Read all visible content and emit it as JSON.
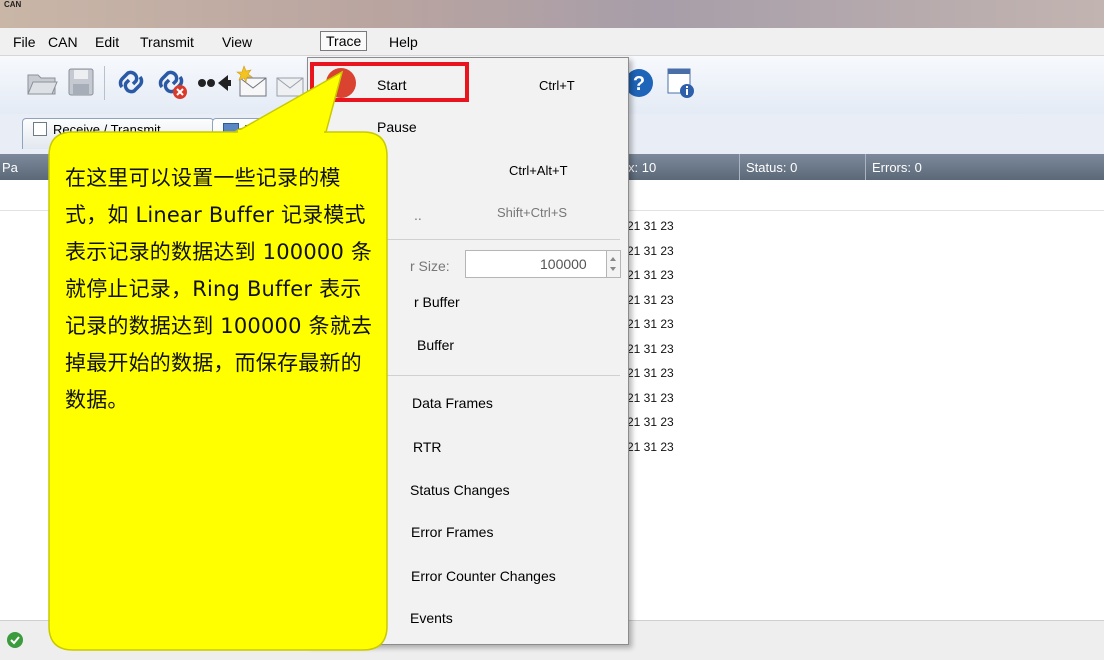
{
  "window": {
    "mini_title": "CAN"
  },
  "menubar": {
    "file": "File",
    "can": "CAN",
    "edit": "Edit",
    "transmit": "Transmit",
    "view": "View",
    "trace": "Trace",
    "help": "Help"
  },
  "tabs": {
    "receive_transmit": "Receive / Transmit",
    "trace": "Tr"
  },
  "status": {
    "rx": "x: 10",
    "status": "Status: 0",
    "errors": "Errors: 0",
    "partial_left": "Pa"
  },
  "trace_rows": [
    "21 31 23",
    "21 31 23",
    "21 31 23",
    "21 31 23",
    "21 31 23",
    "21 31 23",
    "21 31 23",
    "21 31 23",
    "21 31 23",
    "21 31 23"
  ],
  "trace_menu": {
    "start": "Start",
    "start_shortcut": "Ctrl+T",
    "pause": "Pause",
    "item3_shortcut": "Ctrl+Alt+T",
    "item4_partial": "..",
    "item4_shortcut": "Shift+Ctrl+S",
    "buffer_size_label": "r Size:",
    "buffer_size_value": "100000",
    "linear_buffer": "r Buffer",
    "ring_buffer": "Buffer",
    "data_frames": "Data Frames",
    "rtr": "RTR",
    "status_changes": "Status Changes",
    "error_frames": "Error Frames",
    "error_counter_changes": "Error Counter Changes",
    "events": "Events"
  },
  "callout": {
    "text": "在这里可以设置一些记录的模式，如 Linear Buffer 记录模式表示记录的数据达到 100000 条就停止记录，Ring Buffer 表示记录的数据达到 100000 条就去掉最开始的数据，而保存最新的数据。"
  },
  "colors": {
    "highlight": "#e8141e",
    "callout_fill": "#ffff00",
    "record_dot": "#d9432f"
  },
  "icons": [
    "open-folder-icon",
    "save-icon",
    "connect-icon",
    "disconnect-icon",
    "arrow-left-icon",
    "new-message-icon",
    "envelope-icon",
    "help-icon",
    "info-window-icon",
    "check-icon",
    "record-dot-icon"
  ]
}
